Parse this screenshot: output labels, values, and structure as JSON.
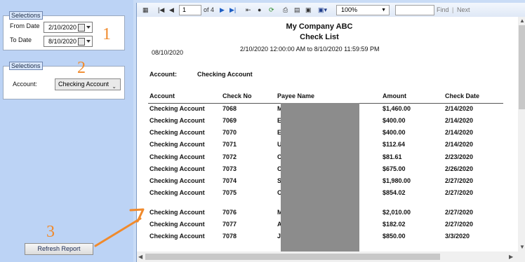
{
  "panel": {
    "group1_title": "Selections",
    "from_label": "From Date",
    "from_value": "2/10/2020",
    "to_label": "To Date",
    "to_value": "8/10/2020",
    "group2_title": "Selections",
    "account_label": "Account:",
    "account_value": "Checking Account",
    "refresh_label": "Refresh Report"
  },
  "annotations": {
    "n1": "1",
    "n2": "2",
    "n3": "3",
    "arrow_color": "#f08a2c"
  },
  "toolbar": {
    "page_current": "1",
    "page_of": "of 4",
    "zoom": "100%",
    "find_label": "Find",
    "next_label": "Next",
    "icons": [
      "document-map-icon",
      "first-page-icon",
      "prev-page-icon",
      "next-page-icon",
      "last-page-icon",
      "back-icon",
      "stop-icon",
      "refresh-icon",
      "print-icon",
      "print-layout-icon",
      "page-setup-icon",
      "export-icon"
    ]
  },
  "report": {
    "company": "My Company ABC",
    "title": "Check List",
    "date_range": "2/10/2020 12:00:00 AM to 8/10/2020 11:59:59 PM",
    "run_date": "08/10/2020",
    "account_label": "Account:",
    "account_value": "Checking Account",
    "columns": [
      "Account",
      "Check No",
      "Payee Name",
      "Amount",
      "Check Date"
    ],
    "rows": [
      {
        "account": "Checking Account",
        "check_no": "7068",
        "payee": "M",
        "amount": "$1,460.00",
        "date": "2/14/2020"
      },
      {
        "account": "Checking Account",
        "check_no": "7069",
        "payee": "E",
        "amount": "$400.00",
        "date": "2/14/2020"
      },
      {
        "account": "Checking Account",
        "check_no": "7070",
        "payee": "E",
        "amount": "$400.00",
        "date": "2/14/2020"
      },
      {
        "account": "Checking Account",
        "check_no": "7071",
        "payee": "U",
        "amount": "$112.64",
        "date": "2/14/2020"
      },
      {
        "account": "Checking Account",
        "check_no": "7072",
        "payee": "C",
        "amount": "$81.61",
        "date": "2/23/2020"
      },
      {
        "account": "Checking Account",
        "check_no": "7073",
        "payee": "C",
        "amount": "$675.00",
        "date": "2/26/2020"
      },
      {
        "account": "Checking Account",
        "check_no": "7074",
        "payee": "S",
        "amount": "$1,980.00",
        "date": "2/27/2020"
      },
      {
        "account": "Checking Account",
        "check_no": "7075",
        "payee": "C",
        "amount": "$854.02",
        "date": "2/27/2020"
      },
      {
        "account": "Checking Account",
        "check_no": "7076",
        "payee": "M",
        "amount": "$2,010.00",
        "date": "2/27/2020"
      },
      {
        "account": "Checking Account",
        "check_no": "7077",
        "payee": "A",
        "amount": "$182.02",
        "date": "2/27/2020"
      },
      {
        "account": "Checking Account",
        "check_no": "7078",
        "payee": "J",
        "amount": "$850.00",
        "date": "3/3/2020"
      }
    ]
  }
}
